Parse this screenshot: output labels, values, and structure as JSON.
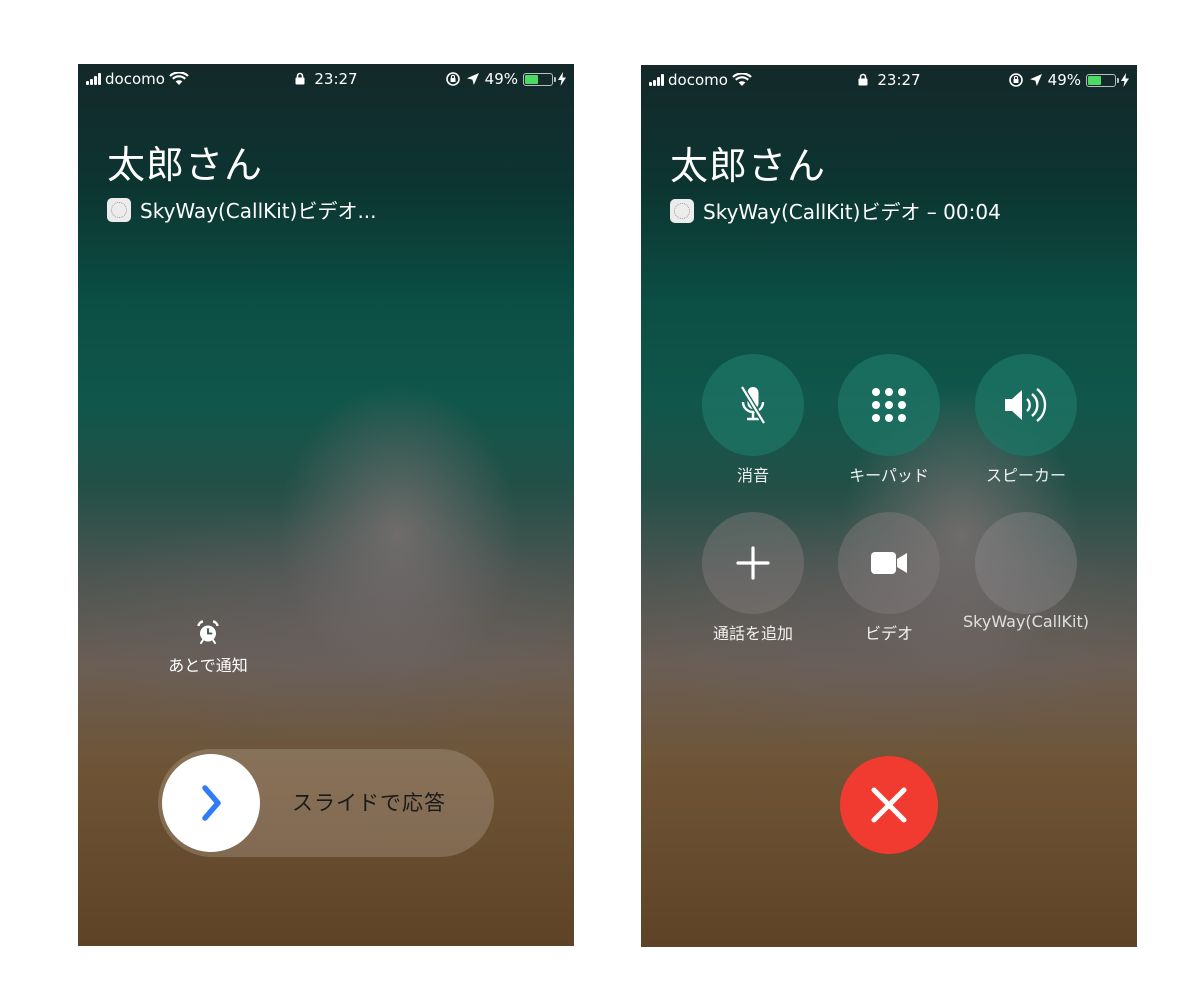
{
  "status_bar": {
    "carrier": "docomo",
    "time": "23:27",
    "battery": "49%",
    "battery_level": 0.49,
    "battery_color": "#4cd964"
  },
  "incoming": {
    "caller": "太郎さん",
    "subtitle": "SkyWay(CallKit)ビデオ...",
    "remind_label": "あとで通知",
    "slide_label": "スライドで応答"
  },
  "in_call": {
    "caller": "太郎さん",
    "subtitle": "SkyWay(CallKit)ビデオ – 00:04",
    "controls": [
      {
        "label": "消音",
        "icon": "microphone-muted-icon"
      },
      {
        "label": "キーパッド",
        "icon": "keypad-icon"
      },
      {
        "label": "スピーカー",
        "icon": "speaker-icon"
      },
      {
        "label": "通話を追加",
        "icon": "plus-icon"
      },
      {
        "label": "ビデオ",
        "icon": "video-camera-icon"
      },
      {
        "label": "SkyWay(CallKit)",
        "icon": "app-icon"
      }
    ],
    "end_color": "#f23b30"
  },
  "colors": {
    "slider_chevron": "#2f7cf6",
    "end_call": "#f23b30"
  }
}
